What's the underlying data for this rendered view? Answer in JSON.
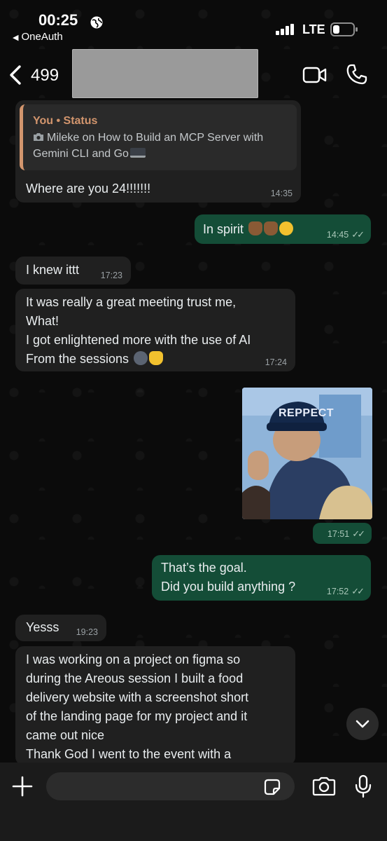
{
  "status_bar": {
    "time": "00:25",
    "back_app": "OneAuth",
    "network": "LTE"
  },
  "header": {
    "unread_count": "499"
  },
  "messages": [
    {
      "direction": "incoming",
      "quote": {
        "sender": "You • Status",
        "text": "Mileke on How to Build an MCP Server with Gemini CLI and Go"
      },
      "text": "Where are you 24!!!!!!!",
      "time": "14:35"
    },
    {
      "direction": "outgoing",
      "text": "In spirit",
      "time": "14:45"
    },
    {
      "direction": "incoming",
      "text": "I knew ittt",
      "time": "17:23"
    },
    {
      "direction": "incoming",
      "lines": [
        "It was really a great meeting trust me,",
        "What!",
        "I got enlightened more with the use of AI",
        "From the sessions"
      ],
      "time": "17:24"
    },
    {
      "direction": "outgoing",
      "type": "image",
      "image_text": "REPPECT",
      "time": "17:51"
    },
    {
      "direction": "outgoing",
      "lines": [
        "That’s the goal.",
        "Did you build anything ?"
      ],
      "time": "17:52"
    },
    {
      "direction": "incoming",
      "text": "Yesss",
      "time": "19:23"
    },
    {
      "direction": "incoming",
      "lines": [
        "I was working on a project on figma so",
        "during the Areous session I built a food",
        "delivery website with a screenshot short",
        "of the landing page for my project and it",
        "came out nice",
        "Thank God I went to the event with a"
      ]
    }
  ],
  "input": {
    "placeholder": ""
  },
  "icons": [
    "globe-icon",
    "signal-icon",
    "battery-icon",
    "back-chevron-icon",
    "video-icon",
    "phone-icon",
    "camera-icon",
    "plus-icon",
    "sticker-icon",
    "mic-icon",
    "chevron-down-icon",
    "read-ticks-icon"
  ],
  "colors": {
    "incoming_bubble": "#202020",
    "outgoing_bubble": "#144d37",
    "quote_accent": "#d2956d",
    "background": "#0b0b0b"
  }
}
